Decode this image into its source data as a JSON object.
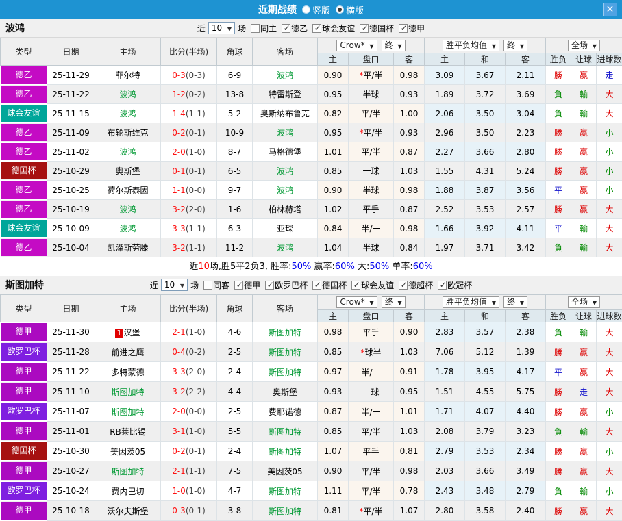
{
  "titlebar": {
    "title": "近期战绩",
    "vertical_label": "竖版",
    "horizontal_label": "横版",
    "selected_layout": "横版",
    "close_label": "✕"
  },
  "colors": {
    "header_bar": "#1E93D2",
    "league": {
      "德乙": "#C40BC4",
      "德甲": "#AB0AC0",
      "球会友谊": "#00A69A",
      "德国杯": "#A61111",
      "欧罗巴杯": "#7F1FE0",
      "result_win": "#DD0000",
      "result_lose": "#008800",
      "result_draw": "#1111CC"
    }
  },
  "filter_labels": {
    "near": "近",
    "games": "场"
  },
  "table_header": {
    "type": "类型",
    "date": "日期",
    "home": "主场",
    "score": "比分(半场)",
    "corner": "角球",
    "away": "客场",
    "crow_dd": "Crow*",
    "final_dd": "终",
    "avg_dd": "胜平负均值",
    "full_dd": "全场",
    "sub": [
      "主",
      "盘口",
      "客",
      "主",
      "和",
      "客",
      "胜负",
      "让球",
      "进球数"
    ]
  },
  "sections": [
    {
      "team": "波鸿",
      "near_count": "10",
      "same_label": "同主",
      "same_checked": false,
      "leagues": [
        "德乙",
        "球会友谊",
        "德国杯",
        "德甲"
      ],
      "rows": [
        {
          "lg": "德乙",
          "date": "25-11-29",
          "home": "菲尔特",
          "home_team": false,
          "rank": null,
          "score": "0-3",
          "half": "(0-3)",
          "corner": "6-9",
          "away": "波鸿",
          "away_team": true,
          "o1": "0.90",
          "hcp": "*平/半",
          "o2": "0.98",
          "a1": "3.09",
          "a2": "3.67",
          "a3": "2.11",
          "res": [
            "勝",
            "r"
          ],
          "let": [
            "赢",
            "r"
          ],
          "gol": [
            "走",
            "b"
          ]
        },
        {
          "lg": "德乙",
          "date": "25-11-22",
          "home": "波鸿",
          "home_team": true,
          "rank": null,
          "score": "1-2",
          "half": "(0-2)",
          "corner": "13-8",
          "away": "特雷斯登",
          "away_team": false,
          "o1": "0.95",
          "hcp": "半球",
          "o2": "0.93",
          "a1": "1.89",
          "a2": "3.72",
          "a3": "3.69",
          "res": [
            "負",
            "g"
          ],
          "let": [
            "輸",
            "g"
          ],
          "gol": [
            "大",
            "r"
          ]
        },
        {
          "lg": "球会友谊",
          "date": "25-11-15",
          "home": "波鸿",
          "home_team": true,
          "rank": null,
          "score": "1-4",
          "half": "(1-1)",
          "corner": "5-2",
          "away": "奥斯纳布鲁克",
          "away_team": false,
          "o1": "0.82",
          "hcp": "平/半",
          "o2": "1.00",
          "a1": "2.06",
          "a2": "3.50",
          "a3": "3.04",
          "res": [
            "負",
            "g"
          ],
          "let": [
            "輸",
            "g"
          ],
          "gol": [
            "大",
            "r"
          ]
        },
        {
          "lg": "德乙",
          "date": "25-11-09",
          "home": "布轮斯维克",
          "home_team": false,
          "rank": null,
          "score": "0-2",
          "half": "(0-1)",
          "corner": "10-9",
          "away": "波鸿",
          "away_team": true,
          "o1": "0.95",
          "hcp": "*平/半",
          "o2": "0.93",
          "a1": "2.96",
          "a2": "3.50",
          "a3": "2.23",
          "res": [
            "勝",
            "r"
          ],
          "let": [
            "赢",
            "r"
          ],
          "gol": [
            "小",
            "g"
          ]
        },
        {
          "lg": "德乙",
          "date": "25-11-02",
          "home": "波鸿",
          "home_team": true,
          "rank": null,
          "score": "2-0",
          "half": "(1-0)",
          "corner": "8-7",
          "away": "马格德堡",
          "away_team": false,
          "o1": "1.01",
          "hcp": "平/半",
          "o2": "0.87",
          "a1": "2.27",
          "a2": "3.66",
          "a3": "2.80",
          "res": [
            "勝",
            "r"
          ],
          "let": [
            "赢",
            "r"
          ],
          "gol": [
            "小",
            "g"
          ]
        },
        {
          "lg": "德国杯",
          "date": "25-10-29",
          "home": "奥斯堡",
          "home_team": false,
          "rank": null,
          "score": "0-1",
          "half": "(0-1)",
          "corner": "6-5",
          "away": "波鸿",
          "away_team": true,
          "o1": "0.85",
          "hcp": "一球",
          "o2": "1.03",
          "a1": "1.55",
          "a2": "4.31",
          "a3": "5.24",
          "res": [
            "勝",
            "r"
          ],
          "let": [
            "赢",
            "r"
          ],
          "gol": [
            "小",
            "g"
          ]
        },
        {
          "lg": "德乙",
          "date": "25-10-25",
          "home": "荷尔斯泰因",
          "home_team": false,
          "rank": null,
          "score": "1-1",
          "half": "(0-0)",
          "corner": "9-7",
          "away": "波鸿",
          "away_team": true,
          "o1": "0.90",
          "hcp": "半球",
          "o2": "0.98",
          "a1": "1.88",
          "a2": "3.87",
          "a3": "3.56",
          "res": [
            "平",
            "b"
          ],
          "let": [
            "赢",
            "r"
          ],
          "gol": [
            "小",
            "g"
          ]
        },
        {
          "lg": "德乙",
          "date": "25-10-19",
          "home": "波鸿",
          "home_team": true,
          "rank": null,
          "score": "3-2",
          "half": "(2-0)",
          "corner": "1-6",
          "away": "柏林赫塔",
          "away_team": false,
          "o1": "1.02",
          "hcp": "平手",
          "o2": "0.87",
          "a1": "2.52",
          "a2": "3.53",
          "a3": "2.57",
          "res": [
            "勝",
            "r"
          ],
          "let": [
            "赢",
            "r"
          ],
          "gol": [
            "大",
            "r"
          ]
        },
        {
          "lg": "球会友谊",
          "date": "25-10-09",
          "home": "波鸿",
          "home_team": true,
          "rank": null,
          "score": "3-3",
          "half": "(1-1)",
          "corner": "6-3",
          "away": "亚琛",
          "away_team": false,
          "o1": "0.84",
          "hcp": "半/一",
          "o2": "0.98",
          "a1": "1.66",
          "a2": "3.92",
          "a3": "4.11",
          "res": [
            "平",
            "b"
          ],
          "let": [
            "輸",
            "g"
          ],
          "gol": [
            "大",
            "r"
          ]
        },
        {
          "lg": "德乙",
          "date": "25-10-04",
          "home": "凯泽斯劳滕",
          "home_team": false,
          "rank": null,
          "score": "3-2",
          "half": "(1-1)",
          "corner": "11-2",
          "away": "波鸿",
          "away_team": true,
          "o1": "1.04",
          "hcp": "半球",
          "o2": "0.84",
          "a1": "1.97",
          "a2": "3.71",
          "a3": "3.42",
          "res": [
            "負",
            "g"
          ],
          "let": [
            "輸",
            "g"
          ],
          "gol": [
            "大",
            "r"
          ]
        }
      ],
      "summary": [
        {
          "t": "近"
        },
        {
          "t": "10",
          "c": "red"
        },
        {
          "t": "场,胜5平2负3, 胜率:"
        },
        {
          "t": "50%",
          "c": "blue"
        },
        {
          "t": " 赢率:"
        },
        {
          "t": "60%",
          "c": "blue"
        },
        {
          "t": " 大:"
        },
        {
          "t": "50%",
          "c": "blue"
        },
        {
          "t": " 单率:"
        },
        {
          "t": "60%",
          "c": "blue"
        }
      ]
    },
    {
      "team": "斯图加特",
      "near_count": "10",
      "same_label": "同客",
      "same_checked": false,
      "leagues": [
        "德甲",
        "欧罗巴杯",
        "德国杯",
        "球会友谊",
        "德超杯",
        "欧冠杯"
      ],
      "rows": [
        {
          "lg": "德甲",
          "date": "25-11-30",
          "home": "汉堡",
          "home_team": false,
          "rank": "1",
          "score": "2-1",
          "half": "(1-0)",
          "corner": "4-6",
          "away": "斯图加特",
          "away_team": true,
          "o1": "0.98",
          "hcp": "平手",
          "o2": "0.90",
          "a1": "2.83",
          "a2": "3.57",
          "a3": "2.38",
          "res": [
            "負",
            "g"
          ],
          "let": [
            "輸",
            "g"
          ],
          "gol": [
            "大",
            "r"
          ]
        },
        {
          "lg": "欧罗巴杯",
          "date": "25-11-28",
          "home": "前进之鹰",
          "home_team": false,
          "rank": null,
          "score": "0-4",
          "half": "(0-2)",
          "corner": "2-5",
          "away": "斯图加特",
          "away_team": true,
          "o1": "0.85",
          "hcp": "*球半",
          "o2": "1.03",
          "a1": "7.06",
          "a2": "5.12",
          "a3": "1.39",
          "res": [
            "勝",
            "r"
          ],
          "let": [
            "赢",
            "r"
          ],
          "gol": [
            "大",
            "r"
          ]
        },
        {
          "lg": "德甲",
          "date": "25-11-22",
          "home": "多特蒙德",
          "home_team": false,
          "rank": null,
          "score": "3-3",
          "half": "(2-0)",
          "corner": "2-4",
          "away": "斯图加特",
          "away_team": true,
          "o1": "0.97",
          "hcp": "半/一",
          "o2": "0.91",
          "a1": "1.78",
          "a2": "3.95",
          "a3": "4.17",
          "res": [
            "平",
            "b"
          ],
          "let": [
            "赢",
            "r"
          ],
          "gol": [
            "大",
            "r"
          ]
        },
        {
          "lg": "德甲",
          "date": "25-11-10",
          "home": "斯图加特",
          "home_team": true,
          "rank": null,
          "score": "3-2",
          "half": "(2-2)",
          "corner": "4-4",
          "away": "奥斯堡",
          "away_team": false,
          "o1": "0.93",
          "hcp": "一球",
          "o2": "0.95",
          "a1": "1.51",
          "a2": "4.55",
          "a3": "5.75",
          "res": [
            "勝",
            "r"
          ],
          "let": [
            "走",
            "b"
          ],
          "gol": [
            "大",
            "r"
          ]
        },
        {
          "lg": "欧罗巴杯",
          "date": "25-11-07",
          "home": "斯图加特",
          "home_team": true,
          "rank": null,
          "score": "2-0",
          "half": "(0-0)",
          "corner": "2-5",
          "away": "费耶诺德",
          "away_team": false,
          "o1": "0.87",
          "hcp": "半/一",
          "o2": "1.01",
          "a1": "1.71",
          "a2": "4.07",
          "a3": "4.40",
          "res": [
            "勝",
            "r"
          ],
          "let": [
            "赢",
            "r"
          ],
          "gol": [
            "小",
            "g"
          ]
        },
        {
          "lg": "德甲",
          "date": "25-11-01",
          "home": "RB莱比锡",
          "home_team": false,
          "rank": null,
          "score": "3-1",
          "half": "(1-0)",
          "corner": "5-5",
          "away": "斯图加特",
          "away_team": true,
          "o1": "0.85",
          "hcp": "平/半",
          "o2": "1.03",
          "a1": "2.08",
          "a2": "3.79",
          "a3": "3.23",
          "res": [
            "負",
            "g"
          ],
          "let": [
            "輸",
            "g"
          ],
          "gol": [
            "大",
            "r"
          ]
        },
        {
          "lg": "德国杯",
          "date": "25-10-30",
          "home": "美因茨05",
          "home_team": false,
          "rank": null,
          "score": "0-2",
          "half": "(0-1)",
          "corner": "2-4",
          "away": "斯图加特",
          "away_team": true,
          "o1": "1.07",
          "hcp": "平手",
          "o2": "0.81",
          "a1": "2.79",
          "a2": "3.53",
          "a3": "2.34",
          "res": [
            "勝",
            "r"
          ],
          "let": [
            "赢",
            "r"
          ],
          "gol": [
            "小",
            "g"
          ]
        },
        {
          "lg": "德甲",
          "date": "25-10-27",
          "home": "斯图加特",
          "home_team": true,
          "rank": null,
          "score": "2-1",
          "half": "(1-1)",
          "corner": "7-5",
          "away": "美因茨05",
          "away_team": false,
          "o1": "0.90",
          "hcp": "平/半",
          "o2": "0.98",
          "a1": "2.03",
          "a2": "3.66",
          "a3": "3.49",
          "res": [
            "勝",
            "r"
          ],
          "let": [
            "赢",
            "r"
          ],
          "gol": [
            "大",
            "r"
          ]
        },
        {
          "lg": "欧罗巴杯",
          "date": "25-10-24",
          "home": "费内巴切",
          "home_team": false,
          "rank": null,
          "score": "1-0",
          "half": "(1-0)",
          "corner": "4-7",
          "away": "斯图加特",
          "away_team": true,
          "o1": "1.11",
          "hcp": "平/半",
          "o2": "0.78",
          "a1": "2.43",
          "a2": "3.48",
          "a3": "2.79",
          "res": [
            "負",
            "g"
          ],
          "let": [
            "輸",
            "g"
          ],
          "gol": [
            "小",
            "g"
          ]
        },
        {
          "lg": "德甲",
          "date": "25-10-18",
          "home": "沃尔夫斯堡",
          "home_team": false,
          "rank": null,
          "score": "0-3",
          "half": "(0-1)",
          "corner": "3-8",
          "away": "斯图加特",
          "away_team": true,
          "o1": "0.81",
          "hcp": "*平/半",
          "o2": "1.07",
          "a1": "2.80",
          "a2": "3.58",
          "a3": "2.40",
          "res": [
            "勝",
            "r"
          ],
          "let": [
            "赢",
            "r"
          ],
          "gol": [
            "大",
            "r"
          ]
        }
      ],
      "summary": null
    }
  ]
}
